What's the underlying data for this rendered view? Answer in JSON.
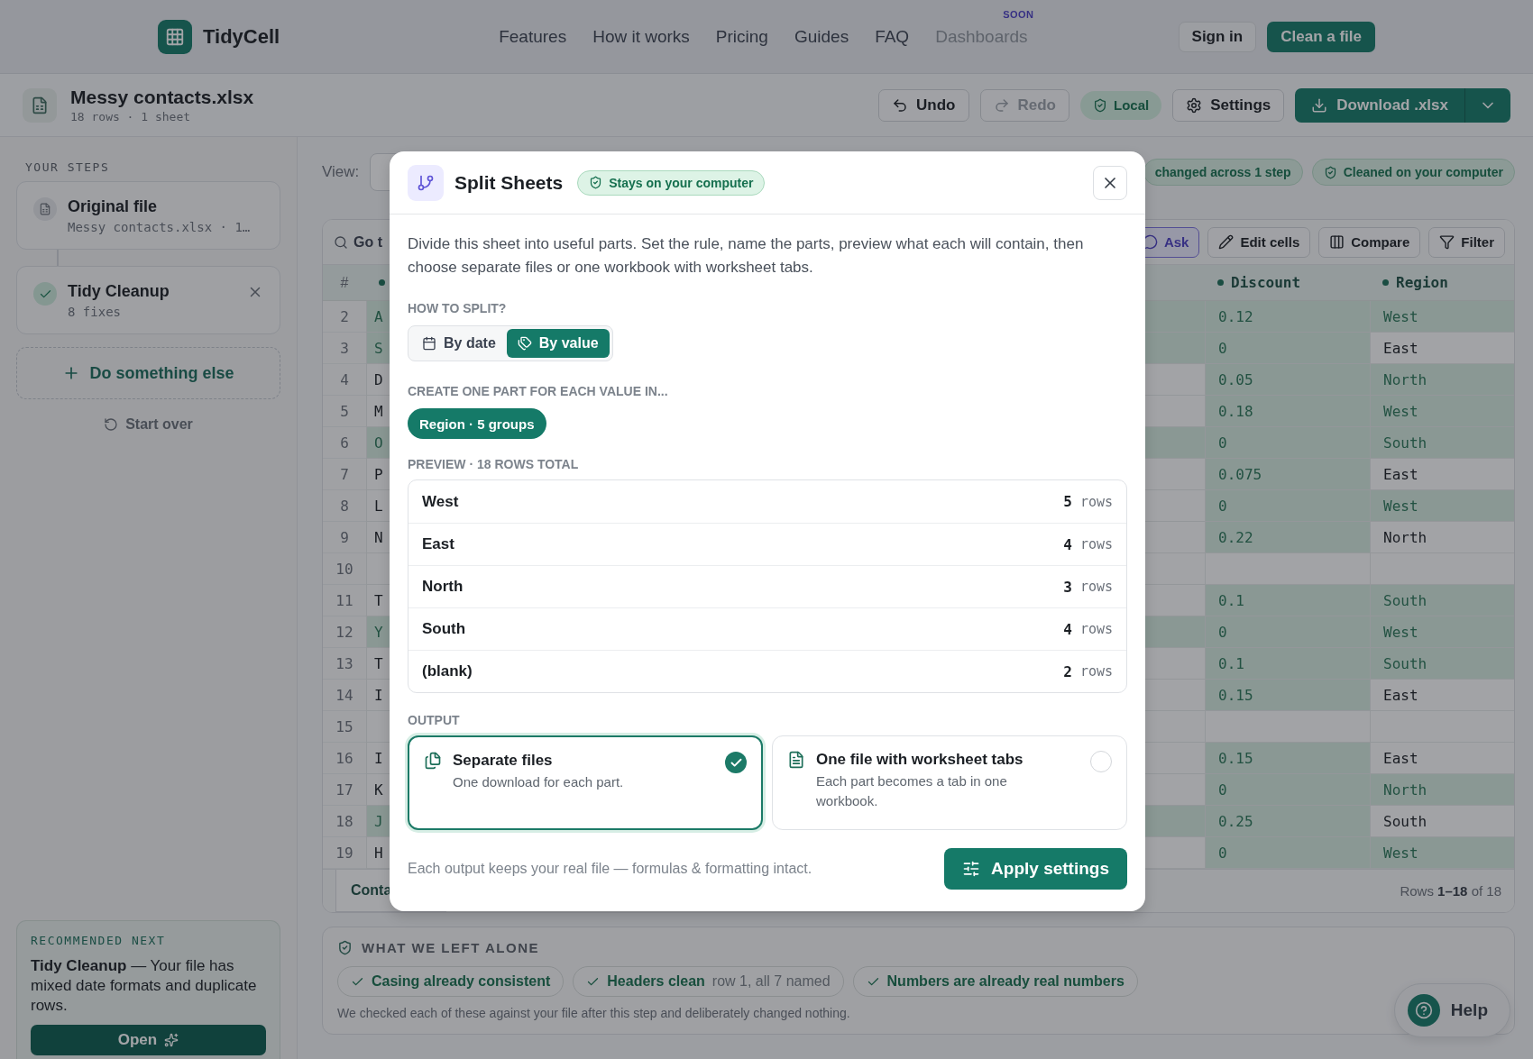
{
  "nav": {
    "brand": "TidyCell",
    "links": [
      {
        "label": "Features",
        "disabled": false
      },
      {
        "label": "How it works",
        "disabled": false
      },
      {
        "label": "Pricing",
        "disabled": false
      },
      {
        "label": "Guides",
        "disabled": false
      },
      {
        "label": "FAQ",
        "disabled": false
      },
      {
        "label": "Dashboards",
        "disabled": true,
        "badge": "SOON"
      }
    ],
    "sign_in": "Sign in",
    "cta": "Clean a file"
  },
  "file_bar": {
    "title": "Messy contacts.xlsx",
    "subtitle": "18 rows · 1 sheet",
    "buttons": [
      {
        "kind": "button",
        "label": "Undo",
        "disabled": false
      },
      {
        "kind": "button",
        "label": "Redo",
        "disabled": true
      },
      {
        "kind": "status",
        "label": "Local"
      },
      {
        "kind": "button",
        "label": "Settings",
        "disabled": false
      }
    ],
    "download": "Download .xlsx"
  },
  "sidebar": {
    "heading": "YOUR STEPS",
    "steps": [
      {
        "title": "Original file",
        "detail": "Messy contacts.xlsx · 1…",
        "done": false,
        "removable": false
      },
      {
        "title": "Tidy Cleanup",
        "detail": "8 fixes",
        "done": true,
        "removable": true
      }
    ],
    "add": "Do something else",
    "reset": "Start over",
    "recommend": {
      "heading": "RECOMMENDED NEXT",
      "text": "**Tidy Cleanup** — Your file has mixed date formats and duplicate rows.",
      "button": "Open"
    }
  },
  "main": {
    "view_label": "View:",
    "badges": [
      {
        "label": "changed across 1 step"
      },
      {
        "label": "Cleaned on your computer"
      }
    ]
  },
  "table": {
    "search": "Go t",
    "tools": [
      {
        "label": "Ask",
        "selected": true
      },
      {
        "label": "Edit cells",
        "selected": false
      },
      {
        "label": "Compare",
        "selected": false
      },
      {
        "label": "Filter",
        "selected": false
      }
    ],
    "row_header": "#",
    "columns": [
      {
        "changed": true
      },
      {
        "label": "Discount",
        "changed": true
      },
      {
        "label": "Region",
        "changed": true
      }
    ],
    "rows": [
      {
        "n": "2",
        "cells": [
          {
            "text": "A",
            "changed": true
          },
          {
            "text": "0.12",
            "changed": true
          },
          {
            "text": "West",
            "changed": true
          }
        ]
      },
      {
        "n": "3",
        "cells": [
          {
            "text": "S",
            "changed": true
          },
          {
            "text": "0",
            "changed": true
          },
          {
            "text": "East",
            "changed": false
          }
        ]
      },
      {
        "n": "4",
        "cells": [
          {
            "text": "D",
            "changed": false
          },
          {
            "text": "0.05",
            "changed": true
          },
          {
            "text": "North",
            "changed": true
          }
        ]
      },
      {
        "n": "5",
        "cells": [
          {
            "text": "M",
            "changed": false
          },
          {
            "text": "0.18",
            "changed": true
          },
          {
            "text": "West",
            "changed": true
          }
        ]
      },
      {
        "n": "6",
        "cells": [
          {
            "text": "O",
            "changed": true
          },
          {
            "text": "0",
            "changed": true
          },
          {
            "text": "South",
            "changed": true
          }
        ]
      },
      {
        "n": "7",
        "cells": [
          {
            "text": "P",
            "changed": false
          },
          {
            "text": "0.075",
            "changed": true
          },
          {
            "text": "East",
            "changed": false
          }
        ]
      },
      {
        "n": "8",
        "cells": [
          {
            "text": "L",
            "changed": false
          },
          {
            "text": "0",
            "changed": true
          },
          {
            "text": "West",
            "changed": true
          }
        ]
      },
      {
        "n": "9",
        "cells": [
          {
            "text": "N",
            "changed": false
          },
          {
            "text": "0.22",
            "changed": true
          },
          {
            "text": "North",
            "changed": false
          }
        ]
      },
      {
        "n": "10",
        "cells": [
          {
            "changed": false
          },
          {
            "changed": false
          },
          {
            "changed": false
          }
        ]
      },
      {
        "n": "11",
        "cells": [
          {
            "text": "T",
            "changed": false
          },
          {
            "text": "0.1",
            "changed": true
          },
          {
            "text": "South",
            "changed": true
          }
        ]
      },
      {
        "n": "12",
        "cells": [
          {
            "text": "Y",
            "changed": true
          },
          {
            "text": "0",
            "changed": true
          },
          {
            "text": "West",
            "changed": true
          }
        ]
      },
      {
        "n": "13",
        "cells": [
          {
            "text": "T",
            "changed": false
          },
          {
            "text": "0.1",
            "changed": true
          },
          {
            "text": "South",
            "changed": true
          }
        ]
      },
      {
        "n": "14",
        "cells": [
          {
            "text": "I",
            "changed": false
          },
          {
            "text": "0.15",
            "changed": true
          },
          {
            "text": "East",
            "changed": false
          }
        ]
      },
      {
        "n": "15",
        "cells": [
          {
            "changed": false
          },
          {
            "changed": false
          },
          {
            "changed": false
          }
        ]
      },
      {
        "n": "16",
        "cells": [
          {
            "text": "I",
            "changed": false
          },
          {
            "text": "0.15",
            "changed": true
          },
          {
            "text": "East",
            "changed": false
          }
        ]
      },
      {
        "n": "17",
        "cells": [
          {
            "text": "K",
            "changed": false
          },
          {
            "text": "0",
            "changed": true
          },
          {
            "text": "North",
            "changed": true
          }
        ]
      },
      {
        "n": "18",
        "cells": [
          {
            "text": "J",
            "changed": true
          },
          {
            "text": "0.25",
            "changed": true
          },
          {
            "text": "South",
            "changed": false
          }
        ]
      },
      {
        "n": "19",
        "cells": [
          {
            "text": "H",
            "changed": false
          },
          {
            "text": "0",
            "changed": true
          },
          {
            "text": "West",
            "changed": true
          }
        ]
      }
    ],
    "sheet_tab": "Conta",
    "count": "Rows **1–18** of 18"
  },
  "left_alone": {
    "heading": "WHAT WE LEFT ALONE",
    "chips": [
      {
        "label": "Casing already consistent"
      },
      {
        "label": "Headers clean",
        "note": "row 1, all 7 named"
      },
      {
        "label": "Numbers are already real numbers"
      }
    ],
    "note": "We checked each of these against your file after this step and deliberately changed nothing."
  },
  "help": "Help",
  "modal": {
    "title": "Split Sheets",
    "badge": "Stays on your computer",
    "intro": "Divide this sheet into useful parts. Set the rule, name the parts, preview what each will contain, then choose separate files or one workbook with worksheet tabs.",
    "split_label": "HOW TO SPLIT?",
    "split_options": [
      {
        "label": "By date",
        "selected": false
      },
      {
        "label": "By value",
        "selected": true
      }
    ],
    "group_label": "CREATE ONE PART FOR EACH VALUE IN...",
    "group_chip": "Region · 5 groups",
    "preview_label": "PREVIEW · 18 ROWS TOTAL",
    "preview": [
      {
        "name": "West",
        "count": "5",
        "unit": "rows"
      },
      {
        "name": "East",
        "count": "4",
        "unit": "rows"
      },
      {
        "name": "North",
        "count": "3",
        "unit": "rows"
      },
      {
        "name": "South",
        "count": "4",
        "unit": "rows"
      },
      {
        "name": "(blank)",
        "count": "2",
        "unit": "rows"
      }
    ],
    "output_label": "OUTPUT",
    "outputs": [
      {
        "title": "Separate files",
        "desc": "One download for each part.",
        "selected": true
      },
      {
        "title": "One file with worksheet tabs",
        "desc": "Each part becomes a tab in one workbook.",
        "selected": false
      }
    ],
    "footnote": "Each output keeps your real file — formulas & formatting intact.",
    "apply": "Apply settings"
  }
}
